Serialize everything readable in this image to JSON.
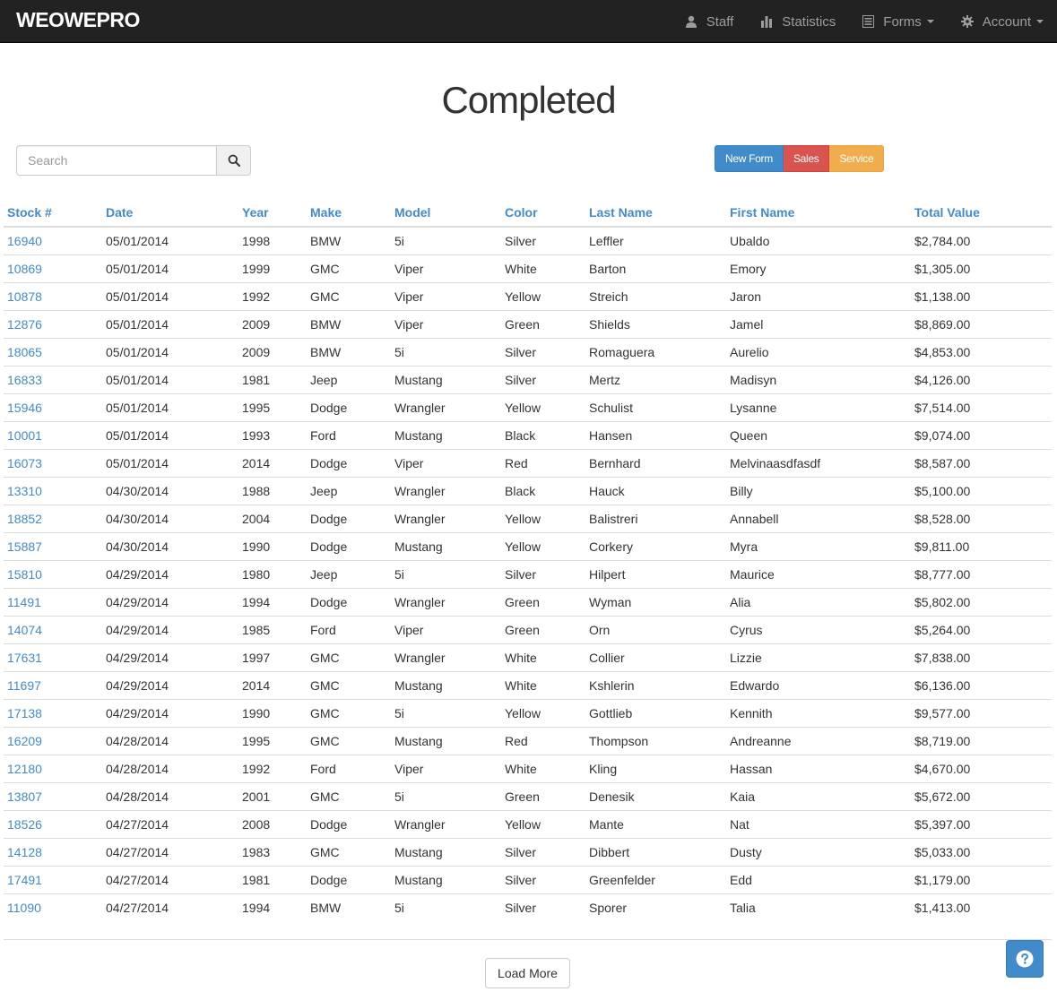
{
  "brand": "WEOWEPRO",
  "nav": [
    {
      "label": "Staff",
      "icon": "user-icon",
      "caret": false
    },
    {
      "label": "Statistics",
      "icon": "stats-icon",
      "caret": false
    },
    {
      "label": "Forms",
      "icon": "list-icon",
      "caret": true
    },
    {
      "label": "Account",
      "icon": "gear-icon",
      "caret": true
    }
  ],
  "page_title": "Completed",
  "search": {
    "placeholder": "Search",
    "value": ""
  },
  "buttons": {
    "new_form": "New Form",
    "sales": "Sales",
    "service": "Service"
  },
  "table": {
    "columns": [
      "Stock #",
      "Date",
      "Year",
      "Make",
      "Model",
      "Color",
      "Last Name",
      "First Name",
      "Total Value"
    ],
    "rows": [
      [
        "16940",
        "05/01/2014",
        "1998",
        "BMW",
        "5i",
        "Silver",
        "Leffler",
        "Ubaldo",
        "$2,784.00"
      ],
      [
        "10869",
        "05/01/2014",
        "1999",
        "GMC",
        "Viper",
        "White",
        "Barton",
        "Emory",
        "$1,305.00"
      ],
      [
        "10878",
        "05/01/2014",
        "1992",
        "GMC",
        "Viper",
        "Yellow",
        "Streich",
        "Jaron",
        "$1,138.00"
      ],
      [
        "12876",
        "05/01/2014",
        "2009",
        "BMW",
        "Viper",
        "Green",
        "Shields",
        "Jamel",
        "$8,869.00"
      ],
      [
        "18065",
        "05/01/2014",
        "2009",
        "BMW",
        "5i",
        "Silver",
        "Romaguera",
        "Aurelio",
        "$4,853.00"
      ],
      [
        "16833",
        "05/01/2014",
        "1981",
        "Jeep",
        "Mustang",
        "Silver",
        "Mertz",
        "Madisyn",
        "$4,126.00"
      ],
      [
        "15946",
        "05/01/2014",
        "1995",
        "Dodge",
        "Wrangler",
        "Yellow",
        "Schulist",
        "Lysanne",
        "$7,514.00"
      ],
      [
        "10001",
        "05/01/2014",
        "1993",
        "Ford",
        "Mustang",
        "Black",
        "Hansen",
        "Queen",
        "$9,074.00"
      ],
      [
        "16073",
        "05/01/2014",
        "2014",
        "Dodge",
        "Viper",
        "Red",
        "Bernhard",
        "Melvinaasdfasdf",
        "$8,587.00"
      ],
      [
        "13310",
        "04/30/2014",
        "1988",
        "Jeep",
        "Wrangler",
        "Black",
        "Hauck",
        "Billy",
        "$5,100.00"
      ],
      [
        "18852",
        "04/30/2014",
        "2004",
        "Dodge",
        "Wrangler",
        "Yellow",
        "Balistreri",
        "Annabell",
        "$8,528.00"
      ],
      [
        "15887",
        "04/30/2014",
        "1990",
        "Dodge",
        "Mustang",
        "Yellow",
        "Corkery",
        "Myra",
        "$9,811.00"
      ],
      [
        "15810",
        "04/29/2014",
        "1980",
        "Jeep",
        "5i",
        "Silver",
        "Hilpert",
        "Maurice",
        "$8,777.00"
      ],
      [
        "11491",
        "04/29/2014",
        "1994",
        "Dodge",
        "Wrangler",
        "Green",
        "Wyman",
        "Alia",
        "$5,802.00"
      ],
      [
        "14074",
        "04/29/2014",
        "1985",
        "Ford",
        "Viper",
        "Green",
        "Orn",
        "Cyrus",
        "$5,264.00"
      ],
      [
        "17631",
        "04/29/2014",
        "1997",
        "GMC",
        "Wrangler",
        "White",
        "Collier",
        "Lizzie",
        "$7,838.00"
      ],
      [
        "11697",
        "04/29/2014",
        "2014",
        "GMC",
        "Mustang",
        "White",
        "Kshlerin",
        "Edwardo",
        "$6,136.00"
      ],
      [
        "17138",
        "04/29/2014",
        "1990",
        "GMC",
        "5i",
        "Yellow",
        "Gottlieb",
        "Kennith",
        "$9,577.00"
      ],
      [
        "16209",
        "04/28/2014",
        "1995",
        "GMC",
        "Mustang",
        "Red",
        "Thompson",
        "Andreanne",
        "$8,719.00"
      ],
      [
        "12180",
        "04/28/2014",
        "1992",
        "Ford",
        "Viper",
        "White",
        "Kling",
        "Hassan",
        "$4,670.00"
      ],
      [
        "13807",
        "04/28/2014",
        "2001",
        "GMC",
        "5i",
        "Green",
        "Denesik",
        "Kaia",
        "$5,672.00"
      ],
      [
        "18526",
        "04/27/2014",
        "2008",
        "Dodge",
        "Wrangler",
        "Yellow",
        "Mante",
        "Nat",
        "$5,397.00"
      ],
      [
        "14128",
        "04/27/2014",
        "1983",
        "GMC",
        "Mustang",
        "Silver",
        "Dibbert",
        "Dusty",
        "$5,033.00"
      ],
      [
        "17491",
        "04/27/2014",
        "1981",
        "Dodge",
        "Mustang",
        "Silver",
        "Greenfelder",
        "Edd",
        "$1,179.00"
      ],
      [
        "11090",
        "04/27/2014",
        "1994",
        "BMW",
        "5i",
        "Silver",
        "Sporer",
        "Talia",
        "$1,413.00"
      ]
    ]
  },
  "load_more": "Load More",
  "help_icon": "question-circle-icon",
  "colors": {
    "navbar": "#222222",
    "link": "#428bca",
    "primary": "#428bca",
    "danger": "#d9534f",
    "warning": "#f0ad4e"
  }
}
